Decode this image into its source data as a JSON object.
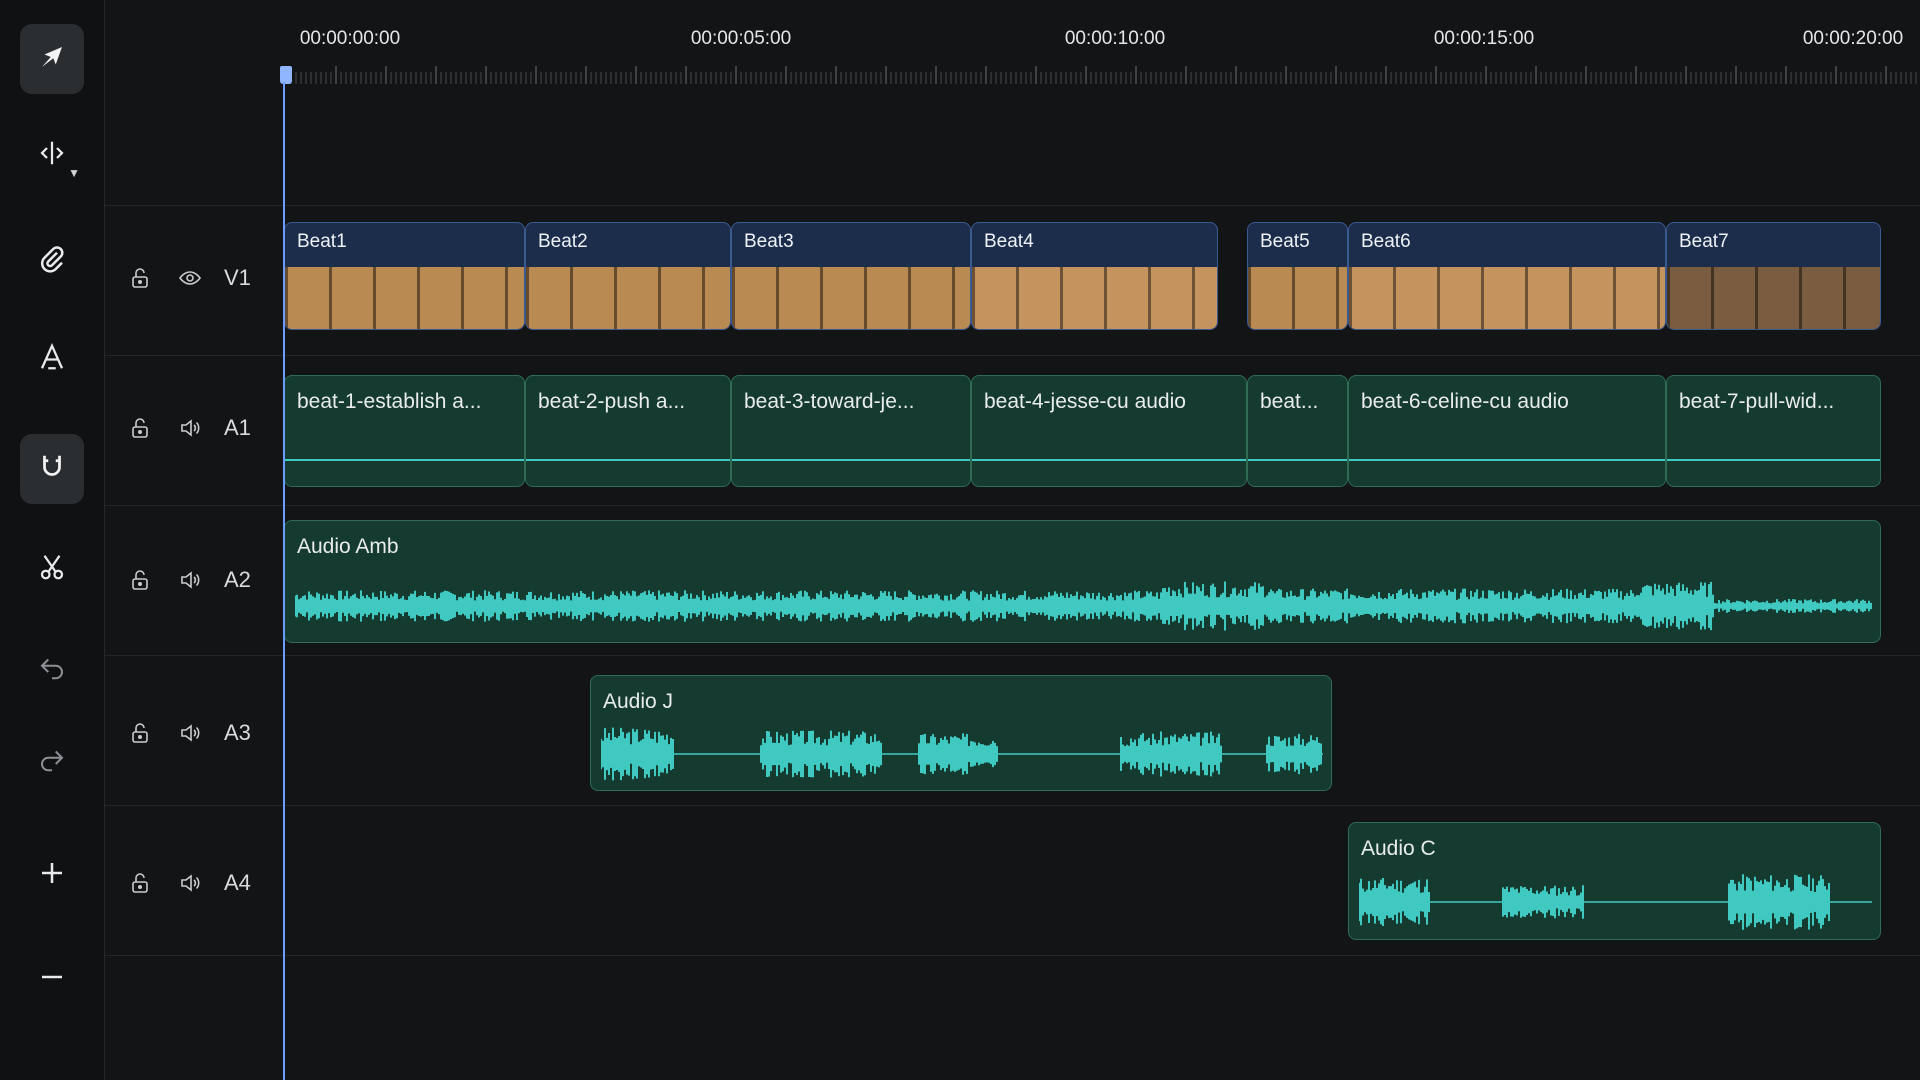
{
  "toolbar": {
    "tools": [
      {
        "name": "select-tool",
        "icon": "pointer-icon",
        "active": true
      },
      {
        "name": "trim-tool",
        "icon": "split-arrows-icon",
        "has_dropdown": true
      },
      {
        "name": "link-tool",
        "icon": "paperclip-icon"
      },
      {
        "name": "text-tool",
        "icon": "text-a-icon"
      },
      {
        "name": "snap-tool",
        "icon": "magnet-icon",
        "active": true
      },
      {
        "name": "cut-tool",
        "icon": "scissors-icon"
      },
      {
        "name": "undo-button",
        "icon": "undo-icon"
      },
      {
        "name": "redo-button",
        "icon": "redo-icon"
      },
      {
        "name": "zoom-in-button",
        "icon": "plus-icon"
      },
      {
        "name": "zoom-out-button",
        "icon": "minus-icon"
      }
    ]
  },
  "ruler": {
    "labels": [
      "00:00:00:00",
      "00:00:05:00",
      "00:00:10:00",
      "00:00:15:00",
      "00:00:20:00"
    ]
  },
  "tracks": [
    {
      "id": "V1",
      "type": "video"
    },
    {
      "id": "A1",
      "type": "audio"
    },
    {
      "id": "A2",
      "type": "audio"
    },
    {
      "id": "A3",
      "type": "audio"
    },
    {
      "id": "A4",
      "type": "audio"
    }
  ],
  "video_clips": [
    "Beat1",
    "Beat2",
    "Beat3",
    "Beat4",
    "Beat5",
    "Beat6",
    "Beat7"
  ],
  "a1_clips": [
    "beat-1-establish a...",
    "beat-2-push a...",
    "beat-3-toward-je...",
    "beat-4-jesse-cu audio",
    "beat...",
    "beat-6-celine-cu audio",
    "beat-7-pull-wid..."
  ],
  "a2_clip": "Audio Amb",
  "a3_clip": "Audio J",
  "a4_clip": "Audio C",
  "colors": {
    "background": "#121416",
    "playhead": "#6a9cff",
    "video_clip": "#1b2d4a",
    "audio_clip": "#153a2f",
    "waveform": "#3fc9c0"
  }
}
